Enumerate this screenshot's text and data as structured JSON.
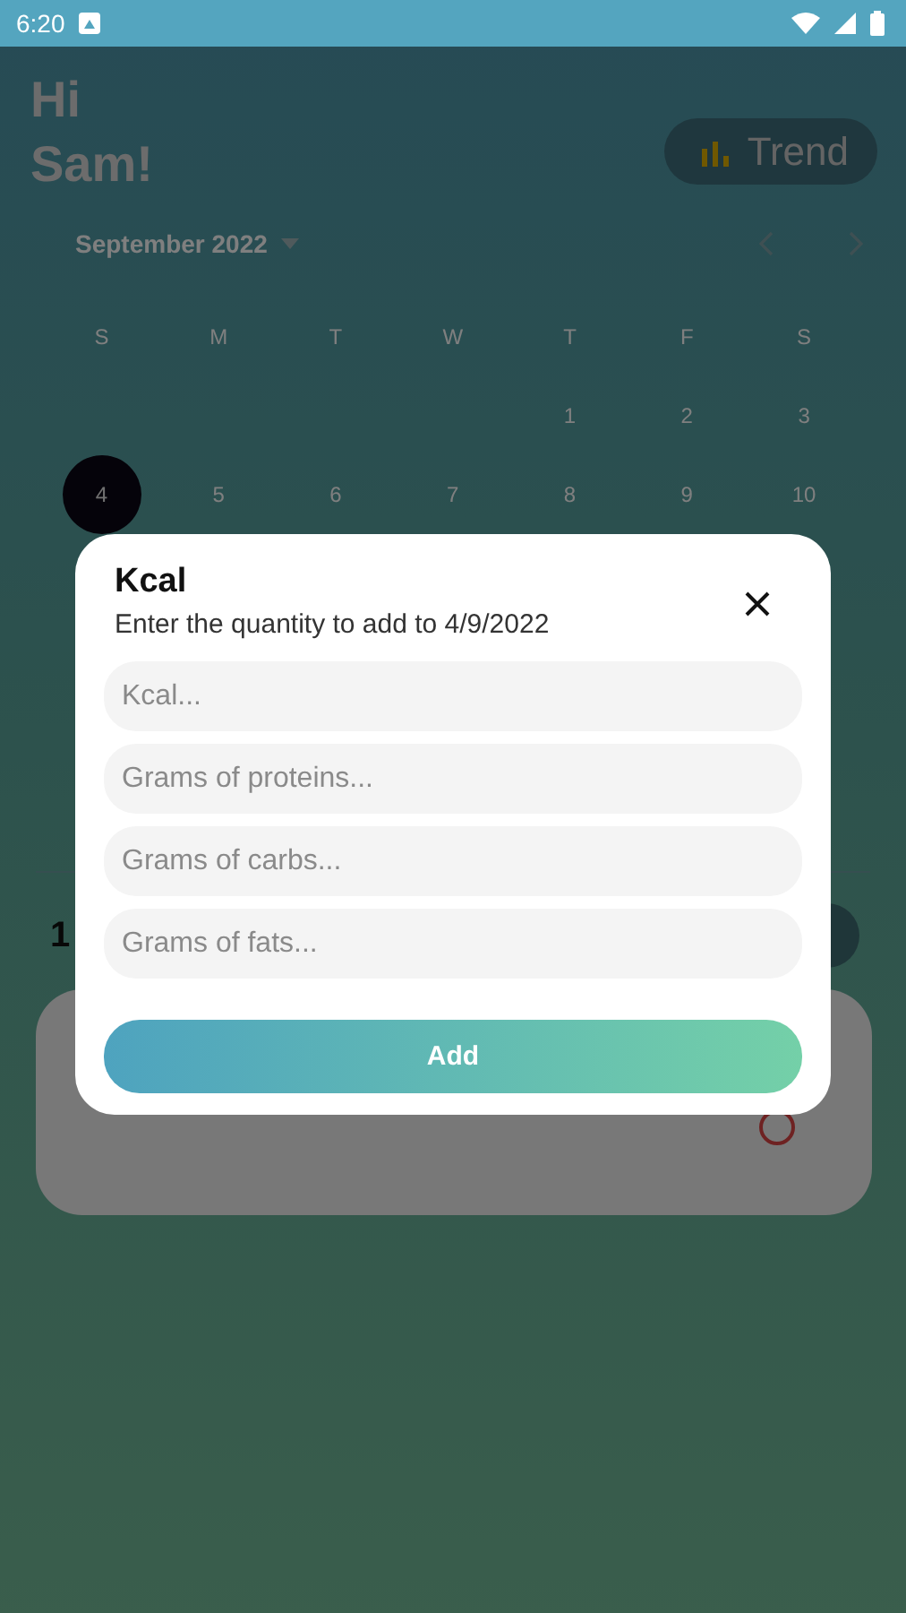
{
  "status_bar": {
    "time": "6:20"
  },
  "header": {
    "greeting": [
      "Hi",
      "Sam!"
    ],
    "trend_button": "Trend"
  },
  "calendar": {
    "month": "September 2022",
    "weekdays": [
      "S",
      "M",
      "T",
      "W",
      "T",
      "F",
      "S"
    ],
    "weeks": [
      [
        {
          "day": "1",
          "selected": false
        },
        {
          "day": "2",
          "selected": false
        },
        {
          "day": "3",
          "selected": false
        }
      ],
      [
        {
          "day": "4",
          "selected": true
        },
        {
          "day": "5",
          "selected": false
        },
        {
          "day": "6",
          "selected": false
        },
        {
          "day": "7",
          "selected": false
        },
        {
          "day": "8",
          "selected": false
        },
        {
          "day": "9",
          "selected": false
        },
        {
          "day": "10",
          "selected": false
        }
      ]
    ]
  },
  "summary": {
    "label": "1"
  },
  "dialog": {
    "title": "Kcal",
    "subtitle": "Enter the quantity to add to 4/9/2022",
    "fields": [
      {
        "placeholder": "Kcal..."
      },
      {
        "placeholder": "Grams of proteins..."
      },
      {
        "placeholder": "Grams of carbs..."
      },
      {
        "placeholder": "Grams of fats..."
      }
    ],
    "add_button": "Add"
  }
}
